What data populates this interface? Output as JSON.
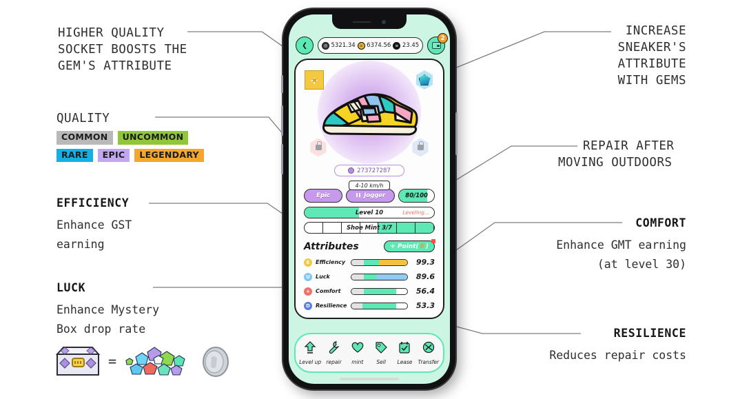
{
  "annotations": {
    "socket": [
      "HIGHER QUALITY",
      "SOCKET BOOSTS THE",
      "GEM'S ATTRIBUTE"
    ],
    "gems": [
      "INCREASE",
      "SNEAKER'S",
      "ATTRIBUTE",
      "WITH GEMS"
    ],
    "repair": [
      "REPAIR AFTER",
      "MOVING OUTDOORS"
    ],
    "quality_title": "QUALITY",
    "efficiency": {
      "title": "EFFICIENCY",
      "lines": [
        "Enhance GST",
        "earning"
      ]
    },
    "luck": {
      "title": "LUCK",
      "lines": [
        "Enhance Mystery",
        "Box drop rate"
      ]
    },
    "comfort": {
      "title": "COMFORT",
      "lines": [
        "Enhance GMT earning",
        "(at level 30)"
      ]
    },
    "resilience": {
      "title": "RESILIENCE",
      "lines": [
        "Reduces repair costs"
      ]
    }
  },
  "quality_levels": [
    {
      "label": "COMMON",
      "color": "#b9b9b9"
    },
    {
      "label": "UNCOMMON",
      "color": "#8fc739"
    },
    {
      "label": "RARE",
      "color": "#13b0e6"
    },
    {
      "label": "EPIC",
      "color": "#c0a7f0"
    },
    {
      "label": "LEGENDARY",
      "color": "#f5a62c"
    }
  ],
  "phone": {
    "topbar": {
      "back_icon": "chevron-left-icon",
      "currencies": [
        {
          "name": "gmt",
          "value": "5321.34"
        },
        {
          "name": "gst",
          "value": "6374.56"
        },
        {
          "name": "sol",
          "value": "23.45"
        }
      ],
      "wallet_icon": "wallet-icon",
      "wallet_badge": "2"
    },
    "sockets": [
      {
        "name": "gem-socket-gold",
        "state": "filled-gold"
      },
      {
        "name": "gem-socket-blue",
        "state": "filled-gem"
      },
      {
        "name": "gem-socket-locked-red",
        "state": "locked"
      },
      {
        "name": "gem-socket-locked-blue",
        "state": "locked"
      }
    ],
    "sneaker_id": "273727287",
    "speed_range": "4-10 km/h",
    "quality_tag": "Epic",
    "type_tag": "Jogger",
    "durability": "80/100",
    "durability_percent": 80,
    "level_label": "Level 10",
    "level_status": "Leveling...",
    "level_percent": 42,
    "mint_label": "Shoe Mint 3/7",
    "mint_used": 3,
    "mint_total": 7,
    "attributes_title": "Attributes",
    "point_button": {
      "prefix": "+ Point(",
      "count": "8",
      "suffix": ")"
    },
    "attributes": [
      {
        "key": "E",
        "label": "Efficiency",
        "value": "99.3",
        "icon_color": "#f5c842",
        "ext_color": "#f3c33f",
        "base": 22,
        "mid": 27,
        "ext": 51
      },
      {
        "key": "U",
        "label": "Luck",
        "value": "89.6",
        "icon_color": "#7fc8f2",
        "ext_color": "#8ecdf3",
        "base": 22,
        "mid": 22,
        "ext": 56
      },
      {
        "key": "+",
        "label": "Comfort",
        "value": "56.4",
        "icon_color": "#f2706c",
        "ext_color": "#5ee8b5",
        "base": 22,
        "mid": 58,
        "ext": 0
      },
      {
        "key": "D",
        "label": "Resilience",
        "value": "53.3",
        "icon_color": "#5b7fe0",
        "ext_color": "#5ee8b5",
        "base": 20,
        "mid": 60,
        "ext": 0
      }
    ],
    "nav": [
      {
        "icon": "level-up-arrow-icon",
        "label": "Level up"
      },
      {
        "icon": "wrench-icon",
        "label": "repair"
      },
      {
        "icon": "heart-icon",
        "label": "mint"
      },
      {
        "icon": "tag-icon",
        "label": "Sell"
      },
      {
        "icon": "calendar-check-icon",
        "label": "Lease"
      },
      {
        "icon": "globe-refresh-icon",
        "label": "Transfer"
      }
    ]
  },
  "mystery_formula": {
    "box_icon": "mystery-box-icon",
    "equals": "=",
    "gems_icon": "gem-pile-icon",
    "coin_icon": "silver-coin-icon"
  },
  "colors": {
    "accent": "#5ee8b5",
    "phone_bg": "#cdf5e4",
    "ink": "#1f1f1f"
  }
}
